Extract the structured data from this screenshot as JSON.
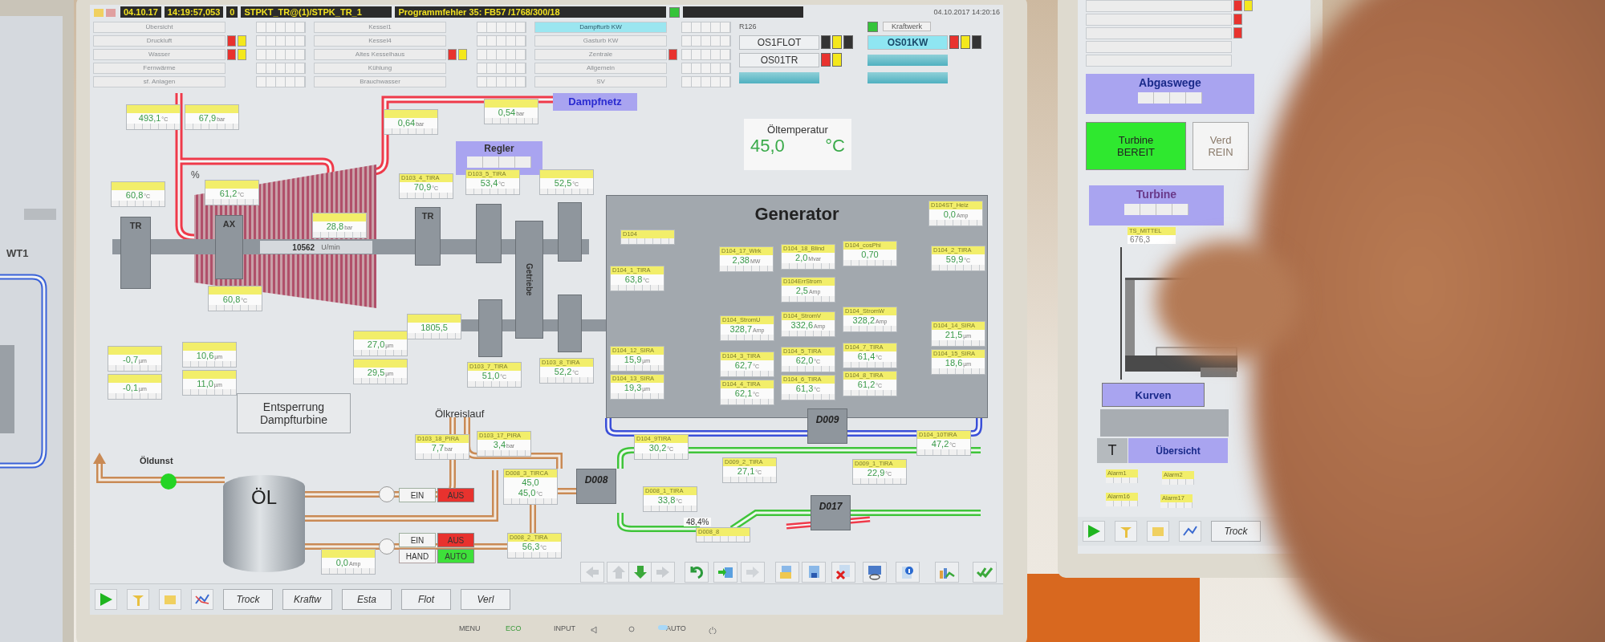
{
  "left_monitor": {
    "label": "WT1"
  },
  "header": {
    "date": "04.10.17",
    "time": "14:19:57,053",
    "counter": "0",
    "path": "STPKT_TR@(1)/STPK_TR_1",
    "message": "Programmfehler 35: FB57 /1768/300/18",
    "timestamp": "04.10.2017 14:20:16",
    "plant": "Kraftwerk",
    "room": "R126"
  },
  "area_columns": [
    [
      {
        "label": "Übersicht",
        "selected": false
      },
      {
        "label": "Druckluft",
        "selected": false,
        "flags": [
          {
            "color": "#e8322e"
          },
          {
            "color": "#f4e81c"
          }
        ]
      },
      {
        "label": "Wasser",
        "selected": false,
        "flags": [
          {
            "color": "#e8322e"
          },
          {
            "color": "#f4e81c"
          }
        ]
      },
      {
        "label": "Fernwärme",
        "selected": false
      },
      {
        "label": "sf. Anlagen",
        "selected": false
      }
    ],
    [
      {
        "label": "Kessel1",
        "selected": false
      },
      {
        "label": "Kessel4",
        "selected": false
      },
      {
        "label": "Altes Kesselhaus",
        "selected": false,
        "flags": [
          {
            "color": "#e8322e"
          },
          {
            "color": "#f4e81c"
          }
        ]
      },
      {
        "label": "Kühlung",
        "selected": false
      },
      {
        "label": "Brauchwasser",
        "selected": false
      }
    ],
    [
      {
        "label": "Dampfturb KW",
        "selected": true
      },
      {
        "label": "Gasturb KW",
        "selected": false
      },
      {
        "label": "Zentrale",
        "selected": false,
        "flags": [
          {
            "color": "#e8322e"
          }
        ]
      },
      {
        "label": "Allgemein",
        "selected": false
      },
      {
        "label": "SV",
        "selected": false
      }
    ]
  ],
  "unit_columns": [
    [
      {
        "kind": "unit",
        "label": "OS1FLOT",
        "selected": false,
        "flags": [
          {
            "color": "#333333"
          },
          {
            "color": "#f4e81c"
          },
          {
            "color": "#333333"
          }
        ]
      },
      {
        "kind": "unit",
        "label": "OS01TR",
        "selected": false,
        "flags": [
          {
            "color": "#e8322e"
          },
          {
            "color": "#f4e81c"
          }
        ]
      },
      {
        "kind": "bar"
      }
    ],
    [
      {
        "kind": "unit",
        "label": "OS01KW",
        "selected": true,
        "flags": [
          {
            "color": "#e8322e"
          },
          {
            "color": "#f4e81c"
          },
          {
            "color": "#333333"
          }
        ]
      },
      {
        "kind": "bar"
      },
      {
        "kind": "bar"
      }
    ]
  ],
  "diagram": {
    "steam_net": "Dampfnetz",
    "controller": "Regler",
    "oil_temp": {
      "title": "Öltemperatur",
      "value": "45,0",
      "unit": "°C"
    },
    "generator": "Generator",
    "blocks": [
      "TR",
      "AX",
      "TR"
    ],
    "gearbox": "Getriebe",
    "speed": {
      "value": "10562",
      "unit": "U/min"
    },
    "percent": "%",
    "release_button": "Entsperrung Dampfturbine",
    "oil_circuit": "Ölkreislauf",
    "oil_vapour": "Öldunst",
    "tank": "ÖL",
    "nodes": [
      "D009",
      "D008",
      "D017"
    ],
    "valve_reading": "48,4%",
    "pump_controls": [
      [
        {
          "label": "EIN",
          "kind": "on",
          "selected": false
        },
        {
          "label": "AUS",
          "kind": "off",
          "selected": true
        }
      ],
      [
        {
          "label": "EIN",
          "kind": "on",
          "selected": false
        },
        {
          "label": "AUS",
          "kind": "off",
          "selected": true
        },
        {
          "label": "HAND",
          "kind": "manual",
          "selected": false
        },
        {
          "label": "AUTO",
          "kind": "auto",
          "selected": true
        }
      ]
    ]
  },
  "turbine_tags": [
    {
      "readings": [
        {
          "value": "493,1",
          "unit": "°C"
        }
      ]
    },
    {
      "readings": [
        {
          "value": "67,9",
          "unit": "bar"
        }
      ]
    },
    {
      "readings": [
        {
          "value": "0,64",
          "unit": "bar"
        }
      ]
    },
    {
      "readings": [
        {
          "value": "0,54",
          "unit": "bar"
        }
      ]
    },
    {
      "readings": [
        {
          "value": "60,8",
          "unit": "°C"
        }
      ]
    },
    {
      "readings": [
        {
          "value": "61,2",
          "unit": "°C"
        }
      ]
    },
    {
      "readings": [
        {
          "value": "28,8",
          "unit": "bar"
        }
      ]
    },
    {
      "label": "D103_4_TIRA",
      "readings": [
        {
          "value": "70,9",
          "unit": "°C"
        }
      ]
    },
    {
      "label": "D103_5_TIRA",
      "readings": [
        {
          "value": "53,4",
          "unit": "°C"
        }
      ]
    },
    {
      "readings": [
        {
          "value": "52,5",
          "unit": "°C"
        }
      ]
    },
    {
      "readings": [
        {
          "value": "60,8",
          "unit": "°C"
        }
      ]
    },
    {
      "readings": [
        {
          "value": "-0,7",
          "unit": "µm"
        }
      ]
    },
    {
      "readings": [
        {
          "value": "-0,1",
          "unit": "µm"
        }
      ]
    },
    {
      "readings": [
        {
          "value": "10,6",
          "unit": "µm"
        }
      ]
    },
    {
      "readings": [
        {
          "value": "11,0",
          "unit": "µm"
        }
      ]
    },
    {
      "readings": [
        {
          "value": "27,0",
          "unit": "µm"
        }
      ]
    },
    {
      "readings": [
        {
          "value": "29,5",
          "unit": "µm"
        }
      ]
    },
    {
      "readings": [
        {
          "value": "1805,5"
        }
      ]
    },
    {
      "label": "D103_7_TIRA",
      "readings": [
        {
          "value": "51,0",
          "unit": "°C"
        }
      ]
    },
    {
      "label": "D103_8_TIRA",
      "readings": [
        {
          "value": "52,2",
          "unit": "°C"
        }
      ]
    }
  ],
  "generator_tags": [
    {
      "label": "D104ST_Heiz",
      "readings": [
        {
          "value": "0,0",
          "unit": "Amp"
        }
      ]
    },
    {
      "label": "D104"
    },
    {
      "label": "D104_17_Wirk",
      "readings": [
        {
          "value": "2,38",
          "unit": "MW"
        }
      ]
    },
    {
      "label": "D104_18_Blind",
      "readings": [
        {
          "value": "2,0",
          "unit": "Mvar"
        }
      ]
    },
    {
      "label": "D104_cosPhi",
      "readings": [
        {
          "value": "0,70"
        }
      ]
    },
    {
      "label": "D104ErrStrom",
      "readings": [
        {
          "value": "2,5",
          "unit": "Amp"
        }
      ]
    },
    {
      "label": "D104_StromU",
      "readings": [
        {
          "value": "328,7",
          "unit": "Amp"
        }
      ]
    },
    {
      "label": "D104_StromV",
      "readings": [
        {
          "value": "332,6",
          "unit": "Amp"
        }
      ]
    },
    {
      "label": "D104_StromW",
      "readings": [
        {
          "value": "328,2",
          "unit": "Amp"
        }
      ]
    },
    {
      "label": "D104_1_TIRA",
      "readings": [
        {
          "value": "63,8",
          "unit": "°C"
        }
      ]
    },
    {
      "label": "D104_12_SIRA",
      "readings": [
        {
          "value": "15,9",
          "unit": "µm"
        }
      ]
    },
    {
      "label": "D104_13_SIRA",
      "readings": [
        {
          "value": "19,3",
          "unit": "µm"
        }
      ]
    },
    {
      "label": "D104_3_TIRA",
      "readings": [
        {
          "value": "62,7",
          "unit": "°C"
        }
      ]
    },
    {
      "label": "D104_4_TIRA",
      "readings": [
        {
          "value": "62,1",
          "unit": "°C"
        }
      ]
    },
    {
      "label": "D104_5_TIRA",
      "readings": [
        {
          "value": "62,0",
          "unit": "°C"
        }
      ]
    },
    {
      "label": "D104_6_TIRA",
      "readings": [
        {
          "value": "61,3",
          "unit": "°C"
        }
      ]
    },
    {
      "label": "D104_7_TIRA",
      "readings": [
        {
          "value": "61,4",
          "unit": "°C"
        }
      ]
    },
    {
      "label": "D104_8_TIRA",
      "readings": [
        {
          "value": "61,2",
          "unit": "°C"
        }
      ]
    },
    {
      "label": "D104_2_TIRA",
      "readings": [
        {
          "value": "59,9",
          "unit": "°C"
        }
      ]
    },
    {
      "label": "D104_14_SIRA",
      "readings": [
        {
          "value": "21,5",
          "unit": "µm"
        }
      ]
    },
    {
      "label": "D104_15_SIRA",
      "readings": [
        {
          "value": "18,6",
          "unit": "µm"
        }
      ]
    },
    {
      "label": "D104_9TIRA",
      "readings": [
        {
          "value": "30,2",
          "unit": "°C"
        }
      ]
    },
    {
      "label": "D104_10TIRA",
      "readings": [
        {
          "value": "47,2",
          "unit": "°C"
        }
      ]
    }
  ],
  "circuit_tags": [
    {
      "label": "D103_18_PIRA",
      "readings": [
        {
          "value": "7,7",
          "unit": "bar"
        }
      ]
    },
    {
      "label": "D103_17_PIRA",
      "readings": [
        {
          "value": "3,4",
          "unit": "bar"
        }
      ]
    },
    {
      "label": "D009_2_TIRA",
      "readings": [
        {
          "value": "27,1",
          "unit": "°C"
        }
      ]
    },
    {
      "label": "D009_1_TIRA",
      "readings": [
        {
          "value": "22,9",
          "unit": "°C"
        }
      ]
    },
    {
      "label": "D008_3_TIRCA",
      "readings": [
        {
          "value": "45,0"
        },
        {
          "value": "45,0",
          "unit": "°C"
        }
      ]
    },
    {
      "label": "D008_1_TIRA",
      "readings": [
        {
          "value": "33,8",
          "unit": "°C"
        }
      ]
    },
    {
      "label": "D008_2_TIRA",
      "readings": [
        {
          "value": "56,3",
          "unit": "°C"
        }
      ]
    },
    {
      "label": "D008_8"
    },
    {
      "readings": [
        {
          "value": "0,0",
          "unit": "Amp"
        }
      ]
    }
  ],
  "toolbar": {
    "buttons": [
      "Trock",
      "Kraftw",
      "Esta",
      "Flot",
      "Verl"
    ]
  },
  "bezel": {
    "labels": [
      "MENU",
      "ECO",
      "INPUT",
      "AUTO"
    ]
  },
  "right_monitor": {
    "status_rows": [
      {
        "flags": [
          {
            "color": "#e8322e"
          },
          {
            "color": "#f4e81c"
          }
        ]
      },
      {
        "flags": [
          {
            "color": "#e8322e"
          }
        ]
      },
      {
        "flags": [
          {
            "color": "#e8322e"
          }
        ]
      },
      {},
      {}
    ],
    "exhaust_panel": "Abgaswege",
    "ready": {
      "lines": [
        "Turbine",
        "BEREIT"
      ],
      "on": true
    },
    "cut_box": [
      "Verd",
      "REIN"
    ],
    "turbine_panel": "Turbine",
    "tag": {
      "label": "TS_MITTEL",
      "value": "676,3"
    },
    "curves": "Kurven",
    "t_label": "T",
    "overview": "Übersicht",
    "alarms": [
      "Alarm1",
      "Alarm2",
      "Alarm16",
      "Alarm17"
    ],
    "toolbar_button": "Trock"
  }
}
